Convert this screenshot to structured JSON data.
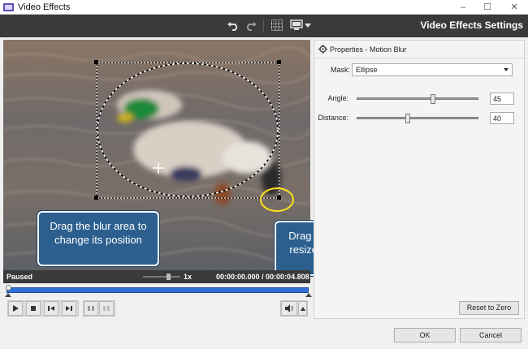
{
  "window": {
    "title": "Video Effects",
    "controls": {
      "minimize": "–",
      "maximize": "☐",
      "close": "✕"
    },
    "icon": "film-icon"
  },
  "toolbar": {
    "settings_title": "Video Effects Settings",
    "icons": [
      "undo-icon",
      "redo-icon",
      "grid-icon",
      "monitor-icon",
      "chevron-down-icon"
    ]
  },
  "video": {
    "status": "Paused",
    "speed": "1x",
    "time": "00:00:00.000 / 00:00:04.808",
    "icons": [
      "move-cross-icon"
    ]
  },
  "callouts": {
    "blur_area": "Drag the blur area to change its position",
    "handles": "Drag the handles to resize the blur area"
  },
  "playback": {
    "icons": [
      "play-icon",
      "stop-icon",
      "previous-frame-icon",
      "next-frame-icon",
      "split-icon",
      "split-disabled-icon",
      "volume-icon",
      "chevron-up-icon"
    ]
  },
  "properties": {
    "header": "Properties - Motion Blur",
    "mask_label": "Mask:",
    "mask_value": "Ellipse",
    "angle_label": "Angle:",
    "angle_value": "45",
    "angle_fraction": 0.63,
    "distance_label": "Distance:",
    "distance_value": "40",
    "distance_fraction": 0.42,
    "reset_label": "Reset to Zero"
  },
  "dialog": {
    "ok_label": "OK",
    "cancel_label": "Cancel"
  },
  "colors": {
    "toolbar_bg": "#3a3a3a",
    "callout_bg": "#2c5f8e",
    "timeline_blue": "#2f6fd6",
    "highlight_yellow": "#ffe21a"
  }
}
